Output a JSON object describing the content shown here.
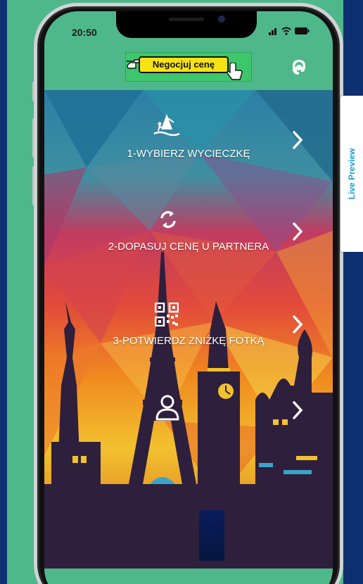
{
  "status_bar": {
    "time": "20:50"
  },
  "header": {
    "banner_label": "Negocjuj cenę",
    "icons": {
      "left_hand": "pointing-hand-icon",
      "right_hand": "cursor-hand-icon",
      "support": "support-agent-icon"
    }
  },
  "menu": [
    {
      "label": "1-WYBIERZ WYCIECZKĘ",
      "icon": "windsurf-icon"
    },
    {
      "label": "2-DOPASUJ CENĘ U PARTNERA",
      "icon": "refresh-icon"
    },
    {
      "label": "3-POTWIERDZ ZNIŻKĘ FOTKĄ",
      "icon": "qr-code-icon"
    },
    {
      "label": "",
      "icon": "user-icon"
    }
  ],
  "live_preview": {
    "label": "Live Preview"
  },
  "colors": {
    "page_bg": "#0f3070",
    "app_bg": "#4fb88a",
    "banner_green": "#3dc66b",
    "banner_yellow": "#f7e314",
    "live_preview_text": "#1b9bd1",
    "silhouette": "#2e1f3c"
  }
}
